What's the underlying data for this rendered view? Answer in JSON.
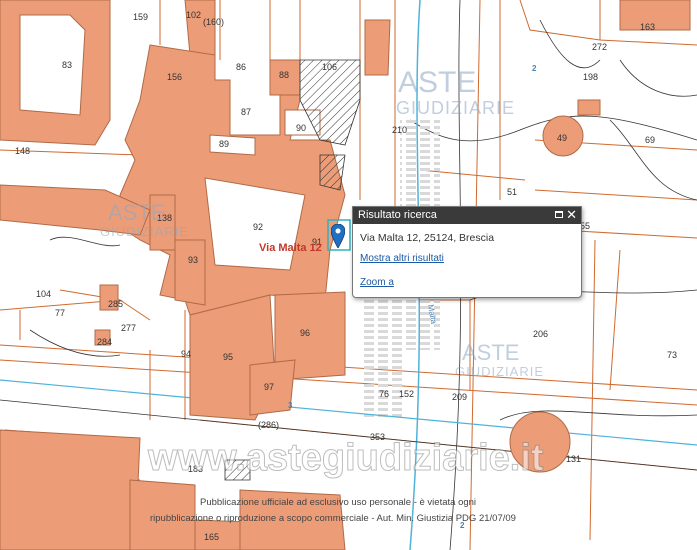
{
  "map": {
    "parcels": {
      "p83": "83",
      "p159": "159",
      "p102": "102",
      "p160": "(160)",
      "p86": "86",
      "p88": "88",
      "p156": "156",
      "p106": "106",
      "p87": "87",
      "p90": "90",
      "p89": "89",
      "p148": "148",
      "p92": "92",
      "p91": "91",
      "p138": "138",
      "p93": "93",
      "p104": "104",
      "p77": "77",
      "p285": "285",
      "p277": "277",
      "p284": "284",
      "p96": "96",
      "p95": "95",
      "p94": "94",
      "p97": "97",
      "p183": "183",
      "p165": "165",
      "p272": "272",
      "p198": "198",
      "p163": "163",
      "p49": "49",
      "p69": "69",
      "p51": "51",
      "p55": "55",
      "p206": "206",
      "p73": "73",
      "p210": "210",
      "p76": "76",
      "p152": "152",
      "p209": "209",
      "p131": "131",
      "p353": "353",
      "p2a": "2",
      "p2b": "2",
      "p3": "3",
      "p286": "(286)"
    },
    "street_label": "Via Malta 12",
    "road_label": "Malta",
    "watermark_brand": "ASTE",
    "watermark_sub": "GIUDIZIARIE",
    "watermark_url": "www.astegiudiziarie.it",
    "disclaimer_line1": "Pubblicazione ufficiale ad esclusivo uso personale - è vietata ogni",
    "disclaimer_line2": "ripubblicazione o riproduzione a scopo commerciale - Aut. Min. Giustizia PDG 21/07/09",
    "colors": {
      "building": "#ec9d78",
      "building_stroke": "#b06a45",
      "lines": "#d06a30",
      "grid": "#c4692e"
    }
  },
  "popup": {
    "title": "Risultato ricerca",
    "address": "Via Malta 12, 25124, Brescia",
    "more_results": "Mostra altri risultati",
    "zoom": "Zoom a"
  }
}
